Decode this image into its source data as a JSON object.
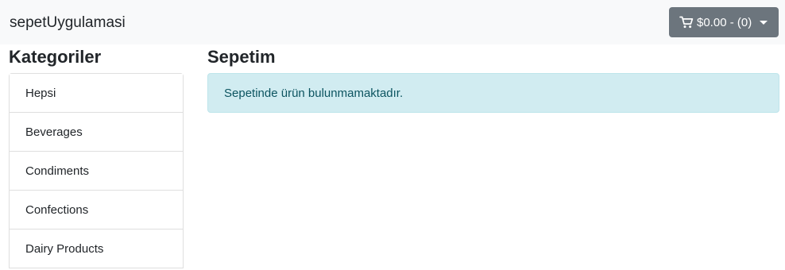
{
  "navbar": {
    "brand": "sepetUygulamasi",
    "cart": {
      "label": "$0.00 - (0)",
      "icon": "cart-icon",
      "color": "#6c757d"
    }
  },
  "sidebar": {
    "title": "Kategoriler",
    "items": [
      {
        "label": "Hepsi"
      },
      {
        "label": "Beverages"
      },
      {
        "label": "Condiments"
      },
      {
        "label": "Confections"
      },
      {
        "label": "Dairy Products"
      }
    ]
  },
  "main": {
    "title": "Sepetim",
    "alert": {
      "text": "Sepetinde ürün bulunmamaktadır.",
      "color": "#d1ecf1"
    }
  }
}
